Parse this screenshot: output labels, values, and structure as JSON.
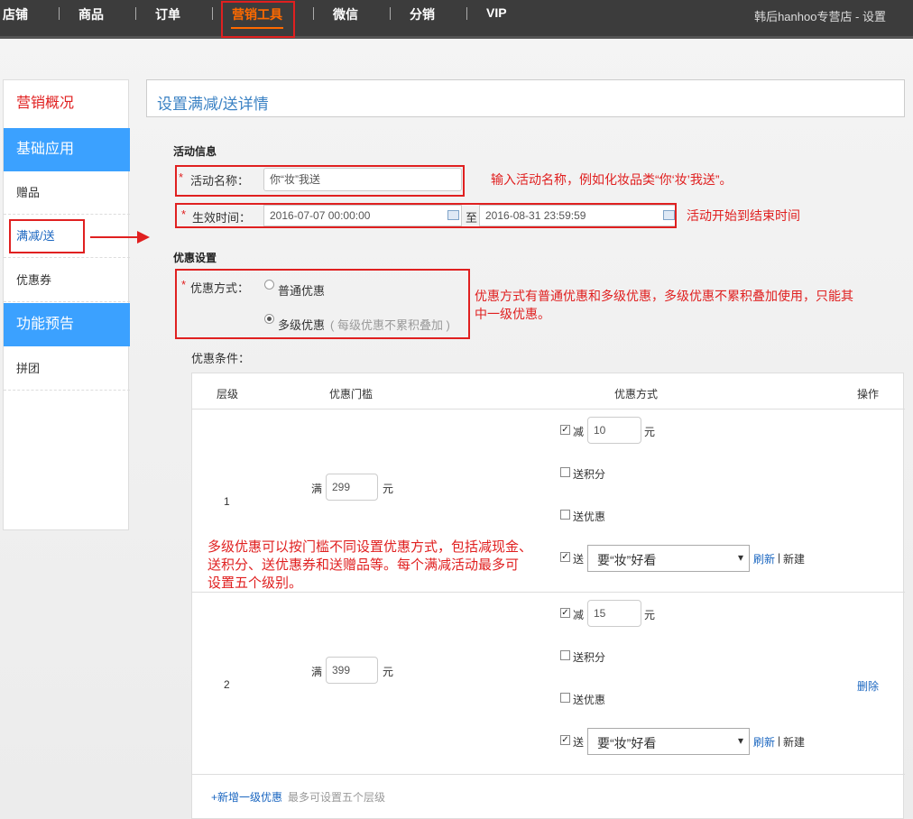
{
  "topnav": {
    "items": [
      "店铺",
      "商品",
      "订单",
      "营销工具",
      "微信",
      "分销",
      "VIP"
    ],
    "active": "营销工具",
    "store_label": "韩后hanhoo专营店 - 设置"
  },
  "sidebar": {
    "overview": "营销概况",
    "section_basic": "基础应用",
    "gift": "赠品",
    "full_reduce": "满减/送",
    "coupon": "优惠券",
    "section_preview": "功能预告",
    "group_buy": "拼团"
  },
  "page_title": "设置满减/送详情",
  "activity": {
    "section": "活动信息",
    "name_label": "活动名称：",
    "name_value": "你“妆”我送",
    "time_label": "生效时间：",
    "start": "2016-07-07 00:00:00",
    "to": "至",
    "end": "2016-08-31 23:59:59"
  },
  "discount": {
    "section": "优惠设置",
    "mode_label": "优惠方式：",
    "normal": "普通优惠",
    "multi": "多级优惠",
    "multi_note": "( 每级优惠不累积叠加 )",
    "condition_label": "优惠条件："
  },
  "table": {
    "headers": [
      "层级",
      "优惠门槛",
      "优惠方式",
      "操作"
    ],
    "rows": [
      {
        "level": "1",
        "prefix": "满",
        "threshold": "299",
        "unit": "元",
        "reduce_label": "减",
        "reduce": "10",
        "reduce_unit": "元",
        "points": "送积分",
        "coupon": "送优惠",
        "gift_label": "送",
        "gift": "要“妆”好看",
        "refresh": "刷新",
        "sep": "|",
        "new": "新建",
        "action": ""
      },
      {
        "level": "2",
        "prefix": "满",
        "threshold": "399",
        "unit": "元",
        "reduce_label": "减",
        "reduce": "15",
        "reduce_unit": "元",
        "points": "送积分",
        "coupon": "送优惠",
        "gift_label": "送",
        "gift": "要“妆”好看",
        "refresh": "刷新",
        "sep": "|",
        "new": "新建",
        "action": "删除"
      }
    ],
    "add_level": "+新增一级优惠",
    "add_note": "最多可设置五个层级"
  },
  "annotations": {
    "name_tip": "输入活动名称，例如化妆品类“你‘妆’我送”。",
    "time_tip": "活动开始到结束时间",
    "mode_tip_1": "优惠方式有普通优惠和多级优惠，多级优惠不累积叠加使用，只能其",
    "mode_tip_2": "中一级优惠。",
    "multi_tip_1": "多级优惠可以按门槛不同设置优惠方式，包括减现金、",
    "multi_tip_2": "送积分、送优惠券和送赠品等。每个满减活动最多可",
    "multi_tip_3": "设置五个级别。"
  },
  "colors": {
    "accent": "#3ba1ff",
    "annotation": "#e02020",
    "nav_active": "#ff6a00"
  }
}
